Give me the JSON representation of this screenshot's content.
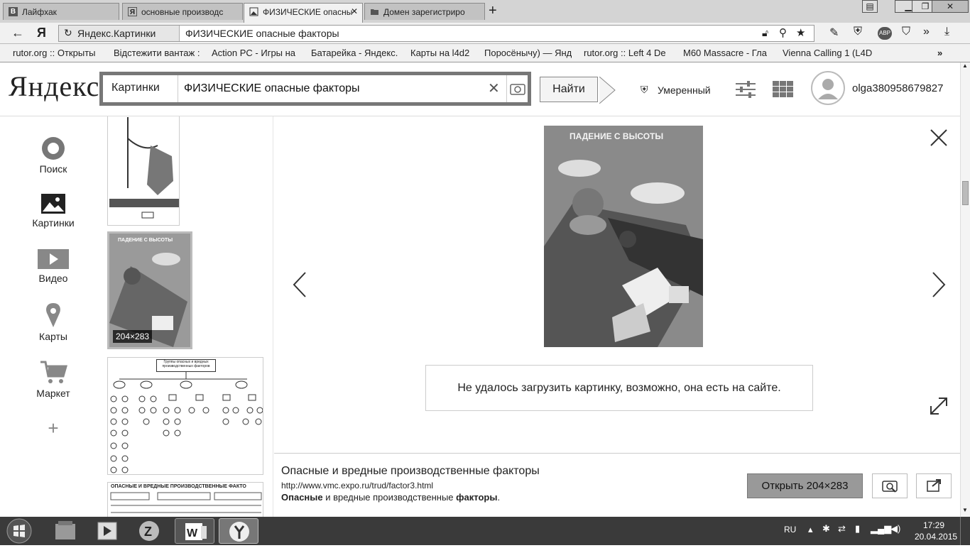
{
  "browser": {
    "tabs": [
      {
        "label": "Лайфхак",
        "icon": "vk-icon"
      },
      {
        "label": "основные производс",
        "icon": "yandex-icon"
      },
      {
        "label": "ФИЗИЧЕСКИЕ опасны",
        "icon": "image-icon"
      },
      {
        "label": "Домен зарегистриро",
        "icon": "folder-icon"
      }
    ],
    "address": {
      "site": "Яндекс.Картинки",
      "query": "ФИЗИЧЕСКИЕ опасные факторы"
    },
    "bookmarks": [
      "rutor.org :: Открыты",
      "Відстежити вантаж :",
      "Action PC - Игры на",
      "Батарейка - Яндекс.",
      "Карты на l4d2",
      "Поросёнычу) — Янд",
      "rutor.org :: Left 4 De",
      "M60 Massacre - Гла",
      "Vienna Calling 1 (L4D"
    ],
    "more_bookmarks": "»"
  },
  "yandex": {
    "logo": "Яндекс",
    "search_service": "Картинки",
    "search_query": "ФИЗИЧЕСКИЕ опасные факторы",
    "find_button": "Найти",
    "safe_search": "Умеренный",
    "username": "olga380958679827"
  },
  "sidebar": {
    "items": [
      {
        "label": "Поиск",
        "icon": "search-circle-icon"
      },
      {
        "label": "Картинки",
        "icon": "picture-icon"
      },
      {
        "label": "Видео",
        "icon": "video-icon"
      },
      {
        "label": "Карты",
        "icon": "map-pin-icon"
      },
      {
        "label": "Маркет",
        "icon": "cart-icon"
      }
    ],
    "add": "+"
  },
  "thumbnails": {
    "selected_size": "204×283",
    "second_title": "ПАДЕНИЕ С ВЫСОТЫ",
    "third_title": "Группы опасных и вредных производственных факторов",
    "fourth_title": "ОПАСНЫЕ И ВРЕДНЫЕ ПРОИЗВОДСТВЕННЫЕ ФАКТО"
  },
  "preview": {
    "image_title": "ПАДЕНИЕ С ВЫСОТЫ",
    "error_message": "Не удалось загрузить картинку, возможно, она есть на сайте.",
    "title": "Опасные и вредные производственные факторы",
    "url": "http://www.vmc.expo.ru/trud/factor3.html",
    "desc_bold1": "Опасные",
    "desc_mid": " и вредные производственные ",
    "desc_bold2": "факторы",
    "desc_end": ".",
    "open_button": "Открыть 204×283"
  },
  "taskbar": {
    "lang": "RU",
    "time": "17:29",
    "date": "20.04.2015"
  }
}
